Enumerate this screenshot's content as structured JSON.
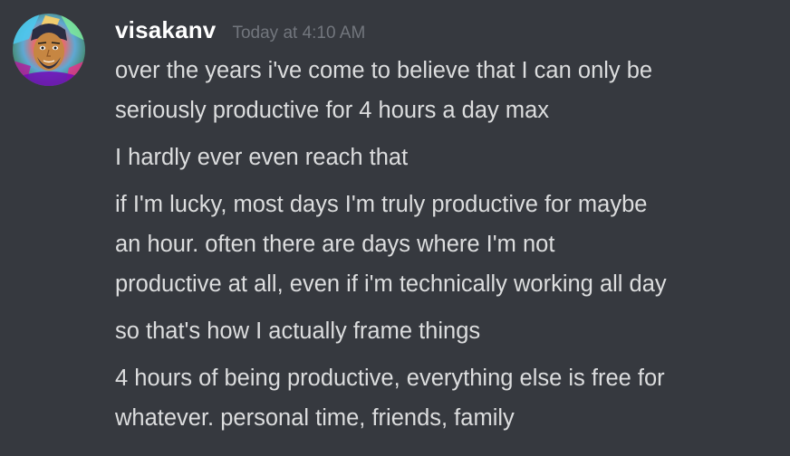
{
  "message": {
    "author": "visakanv",
    "timestamp": "Today at 4:10 AM",
    "avatar_icon": "user-avatar-colorful-portrait",
    "paragraphs": [
      {
        "lines": [
          "over the years i've come to believe that I can only be",
          "seriously productive for 4 hours a day max"
        ]
      },
      {
        "lines": [
          "I hardly ever even reach that"
        ]
      },
      {
        "lines": [
          "if I'm lucky, most days I'm truly productive for maybe",
          "an hour. often there are days where I'm not",
          "productive at all, even if i'm technically working all day"
        ]
      },
      {
        "lines": [
          "so that's how I actually frame things"
        ]
      },
      {
        "lines": [
          "4 hours of being productive, everything else is free for",
          "whatever. personal time, friends, family"
        ]
      }
    ]
  },
  "colors": {
    "background": "#36393f",
    "username": "#ffffff",
    "timestamp": "#72767d",
    "text": "#dcddde"
  }
}
